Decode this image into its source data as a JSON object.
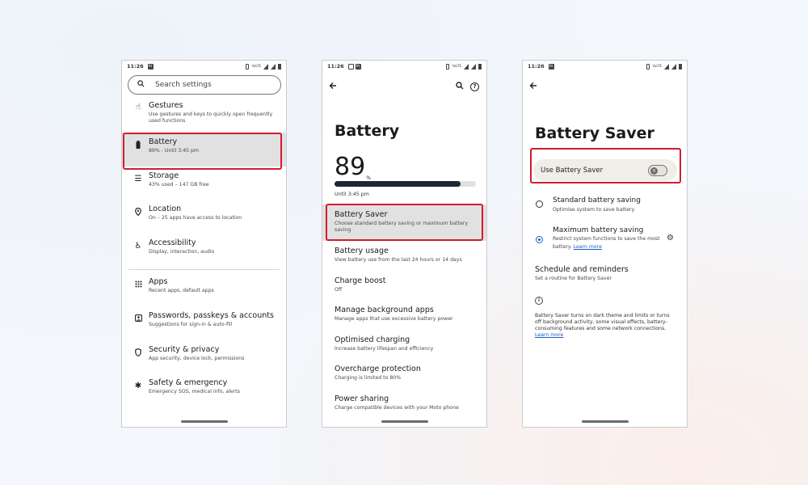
{
  "status": {
    "time": "11:26",
    "app_badge": "in",
    "network": "VoLTE"
  },
  "screen1": {
    "search_placeholder": "Search settings",
    "items": [
      {
        "title": "Gestures",
        "subtitle": "Use gestures and keys to quickly open frequently used functions",
        "icon": "gesture-icon"
      },
      {
        "title": "Battery",
        "subtitle": "89% - Until 3:45 pm",
        "icon": "battery-icon"
      },
      {
        "title": "Storage",
        "subtitle": "43% used – 147 GB free",
        "icon": "storage-icon"
      },
      {
        "title": "Location",
        "subtitle": "On – 25 apps have access to location",
        "icon": "location-icon"
      },
      {
        "title": "Accessibility",
        "subtitle": "Display, interaction, audio",
        "icon": "accessibility-icon"
      },
      {
        "title": "Apps",
        "subtitle": "Recent apps, default apps",
        "icon": "apps-icon"
      },
      {
        "title": "Passwords, passkeys & accounts",
        "subtitle": "Suggestions for sign-in & auto-fill",
        "icon": "accounts-icon"
      },
      {
        "title": "Security & privacy",
        "subtitle": "App security, device lock, permissions",
        "icon": "shield-icon"
      },
      {
        "title": "Safety & emergency",
        "subtitle": "Emergency SOS, medical info, alerts",
        "icon": "emergency-icon"
      }
    ]
  },
  "screen2": {
    "title": "Battery",
    "percent": "89",
    "percent_unit": "%",
    "level_fraction": 0.89,
    "until": "Until 3:45 pm",
    "items": [
      {
        "title": "Battery Saver",
        "subtitle": "Choose standard battery saving or maximum battery saving"
      },
      {
        "title": "Battery usage",
        "subtitle": "View battery use from the last 24 hours or 14 days"
      },
      {
        "title": "Charge boost",
        "subtitle": "Off"
      },
      {
        "title": "Manage background apps",
        "subtitle": "Manage apps that use excessive battery power"
      },
      {
        "title": "Optimised charging",
        "subtitle": "Increase battery lifespan and efficiency"
      },
      {
        "title": "Overcharge protection",
        "subtitle": "Charging is limited to 80%"
      },
      {
        "title": "Power sharing",
        "subtitle": "Charge compatible devices with your Moto phone"
      }
    ]
  },
  "screen3": {
    "title": "Battery Saver",
    "toggle_label": "Use Battery Saver",
    "toggle_on": false,
    "standard": {
      "title": "Standard battery saving",
      "subtitle": "Optimise system to save battery"
    },
    "maximum": {
      "title": "Maximum battery saving",
      "subtitle": "Restrict system functions to save the most battery.",
      "link": "Learn more"
    },
    "schedule": {
      "title": "Schedule and reminders",
      "subtitle": "Set a routine for Battery Saver"
    },
    "info": "Battery Saver turns on dark theme and limits or turns off background activity, some visual effects, battery-consuming features and some network connections.",
    "info_link": "Learn more"
  },
  "colors": {
    "highlight": "#d11c2e",
    "accent": "#1a5fc5",
    "battery_fill": "#202734"
  }
}
